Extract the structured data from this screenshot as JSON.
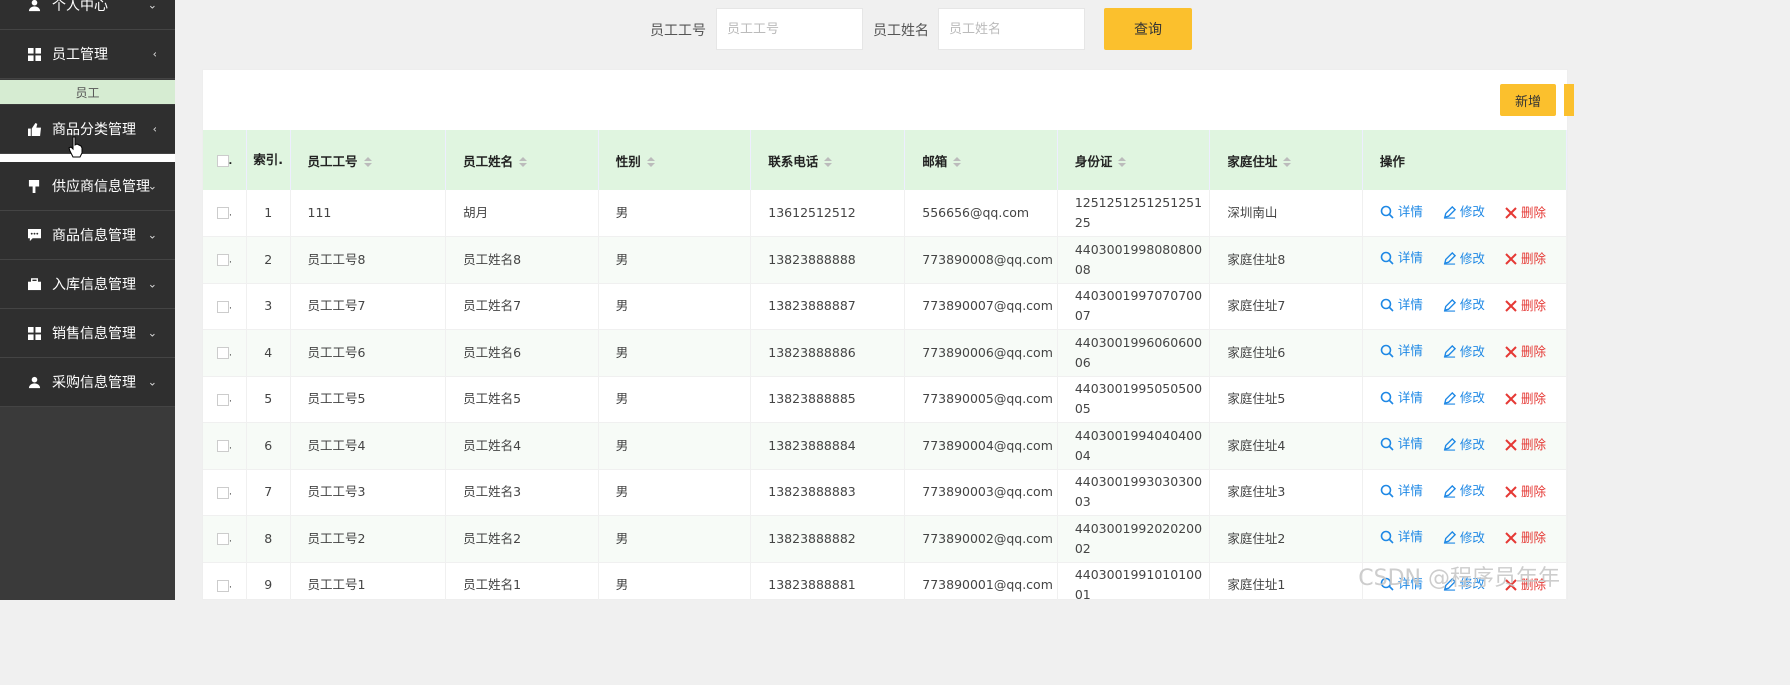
{
  "sidebar": {
    "items": [
      {
        "label": "个人中心",
        "icon": "user-icon",
        "arrow": "⌄"
      },
      {
        "label": "员工管理",
        "icon": "grid-icon",
        "arrow": "‹"
      },
      {
        "label": "商品分类管理",
        "icon": "thumbs-up-icon",
        "arrow": "‹"
      },
      {
        "label": "供应商信息管理",
        "icon": "flag-icon",
        "arrow": "⌄"
      },
      {
        "label": "商品信息管理",
        "icon": "chat-icon",
        "arrow": "⌄"
      },
      {
        "label": "入库信息管理",
        "icon": "briefcase-icon",
        "arrow": "⌄"
      },
      {
        "label": "销售信息管理",
        "icon": "grid-icon",
        "arrow": "⌄"
      },
      {
        "label": "采购信息管理",
        "icon": "user-icon",
        "arrow": "⌄"
      }
    ],
    "submenu_label": "员工"
  },
  "search": {
    "field1_label": "员工工号",
    "field1_placeholder": "员工工号",
    "field2_label": "员工姓名",
    "field2_placeholder": "员工姓名",
    "query_label": "查询"
  },
  "toolbar": {
    "add_label": "新增"
  },
  "table": {
    "headers": {
      "index": "索引.",
      "emp_no": "员工工号",
      "emp_name": "员工姓名",
      "gender": "性别",
      "phone": "联系电话",
      "email": "邮箱",
      "idcard": "身份证",
      "address": "家庭住址",
      "ops": "操作"
    },
    "ops": {
      "detail": "详情",
      "edit": "修改",
      "delete": "删除"
    },
    "rows": [
      {
        "index": "1",
        "emp_no": "111",
        "emp_name": "胡月",
        "gender": "男",
        "phone": "13612512512",
        "email": "556656@qq.com",
        "idcard": "125125125125125125",
        "address": "深圳南山"
      },
      {
        "index": "2",
        "emp_no": "员工工号8",
        "emp_name": "员工姓名8",
        "gender": "男",
        "phone": "13823888888",
        "email": "773890008@qq.com",
        "idcard": "440300199808080008",
        "address": "家庭住址8"
      },
      {
        "index": "3",
        "emp_no": "员工工号7",
        "emp_name": "员工姓名7",
        "gender": "男",
        "phone": "13823888887",
        "email": "773890007@qq.com",
        "idcard": "440300199707070007",
        "address": "家庭住址7"
      },
      {
        "index": "4",
        "emp_no": "员工工号6",
        "emp_name": "员工姓名6",
        "gender": "男",
        "phone": "13823888886",
        "email": "773890006@qq.com",
        "idcard": "440300199606060006",
        "address": "家庭住址6"
      },
      {
        "index": "5",
        "emp_no": "员工工号5",
        "emp_name": "员工姓名5",
        "gender": "男",
        "phone": "13823888885",
        "email": "773890005@qq.com",
        "idcard": "440300199505050005",
        "address": "家庭住址5"
      },
      {
        "index": "6",
        "emp_no": "员工工号4",
        "emp_name": "员工姓名4",
        "gender": "男",
        "phone": "13823888884",
        "email": "773890004@qq.com",
        "idcard": "440300199404040004",
        "address": "家庭住址4"
      },
      {
        "index": "7",
        "emp_no": "员工工号3",
        "emp_name": "员工姓名3",
        "gender": "男",
        "phone": "13823888883",
        "email": "773890003@qq.com",
        "idcard": "440300199303030003",
        "address": "家庭住址3"
      },
      {
        "index": "8",
        "emp_no": "员工工号2",
        "emp_name": "员工姓名2",
        "gender": "男",
        "phone": "13823888882",
        "email": "773890002@qq.com",
        "idcard": "440300199202020002",
        "address": "家庭住址2"
      },
      {
        "index": "9",
        "emp_no": "员工工号1",
        "emp_name": "员工姓名1",
        "gender": "男",
        "phone": "13823888881",
        "email": "773890001@qq.com",
        "idcard": "440300199101010001",
        "address": "家庭住址1"
      }
    ]
  },
  "watermark": "CSDN @程序员年年",
  "colors": {
    "accent": "#fbc02d",
    "header_bg": "#e0f5e0",
    "sidebar_bg": "#2f2f2f",
    "link": "#1e88e5",
    "danger": "#e53935"
  }
}
